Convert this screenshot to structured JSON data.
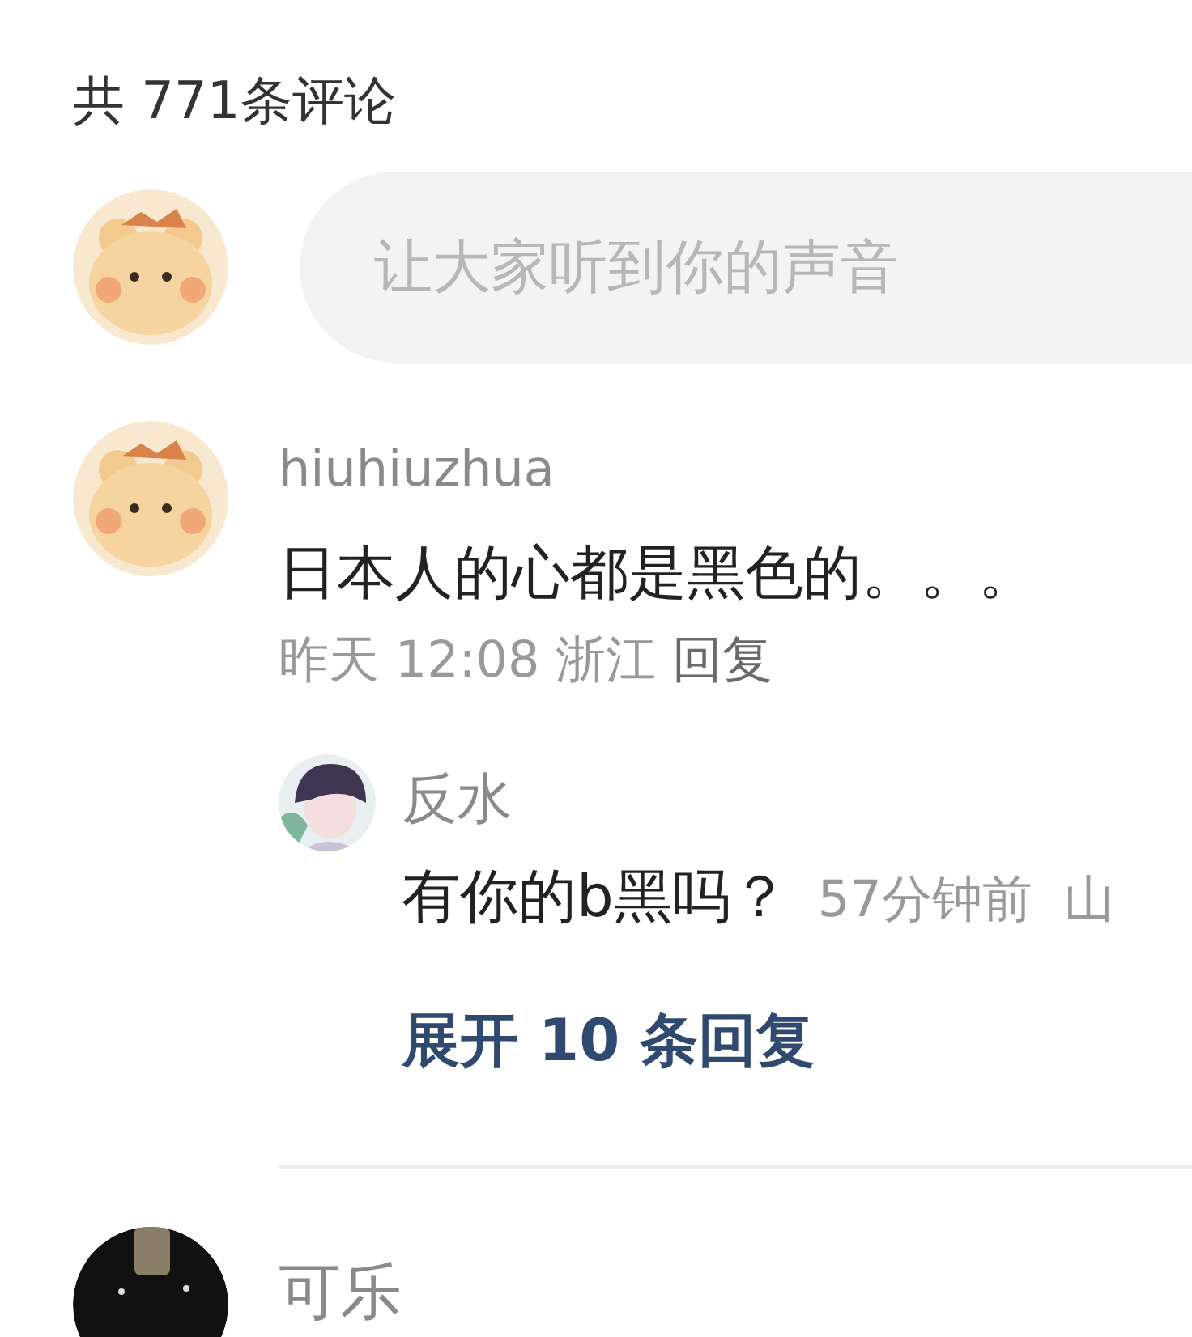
{
  "header": {
    "title": "共 771条评论"
  },
  "composer": {
    "placeholder": "让大家听到你的声音"
  },
  "comments": [
    {
      "kind": "full",
      "author": "hiuhiuzhua",
      "text": "日本人的心都是黑色的。。。",
      "time": "昨天 12:08 浙江",
      "reply_label": "回复",
      "replies": [
        {
          "author": "反水",
          "text": "有你的b黑吗？",
          "meta": "57分钟前  山"
        }
      ],
      "expand": "展开 10 条回复"
    },
    {
      "kind": "partial",
      "author": "可乐"
    }
  ]
}
